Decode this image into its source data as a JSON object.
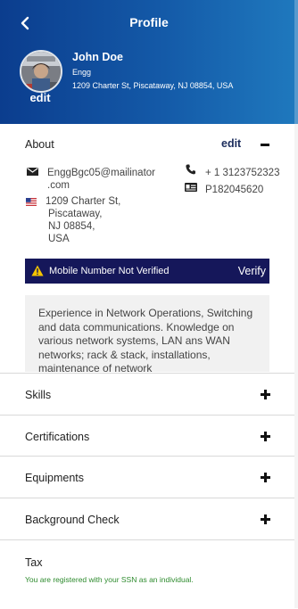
{
  "header": {
    "title": "Profile",
    "back_icon": "chevron-left-icon",
    "user": {
      "name": "John Doe",
      "role": "Engg",
      "address": "1209 Charter St, Piscataway, NJ 08854, USA",
      "avatar_edit_label": "edit"
    }
  },
  "about": {
    "title": "About",
    "edit_label": "edit",
    "collapse_icon": "minus-icon",
    "email_line1": "EnggBgc05@mailinator",
    "email_line2": ".com",
    "address_lines": [
      "1209 Charter St,",
      "Piscataway,",
      "NJ 08854,",
      "USA"
    ],
    "phone": "+ 1 3123752323",
    "id_number": "P182045620",
    "warning": {
      "text": "Mobile Number Not Verified",
      "action_label": "Verify",
      "color": "#15175a"
    },
    "bio": "Experience in Network Operations, Switching and data communications. Knowledge on various network systems, LAN ans WAN networks; rack & stack, installations, maintenance of network"
  },
  "sections": [
    {
      "label": "Skills",
      "icon": "plus-icon"
    },
    {
      "label": "Certifications",
      "icon": "plus-icon"
    },
    {
      "label": "Equipments",
      "icon": "plus-icon"
    },
    {
      "label": "Background Check",
      "icon": "plus-icon"
    }
  ],
  "tax": {
    "label": "Tax",
    "note": "You are registered with your SSN as an individual.",
    "note_color": "#2e8b2e"
  },
  "colors": {
    "header_gradient_start": "#0b3d8e",
    "header_gradient_end": "#1f79be",
    "edit_link": "#1b2c5c"
  }
}
